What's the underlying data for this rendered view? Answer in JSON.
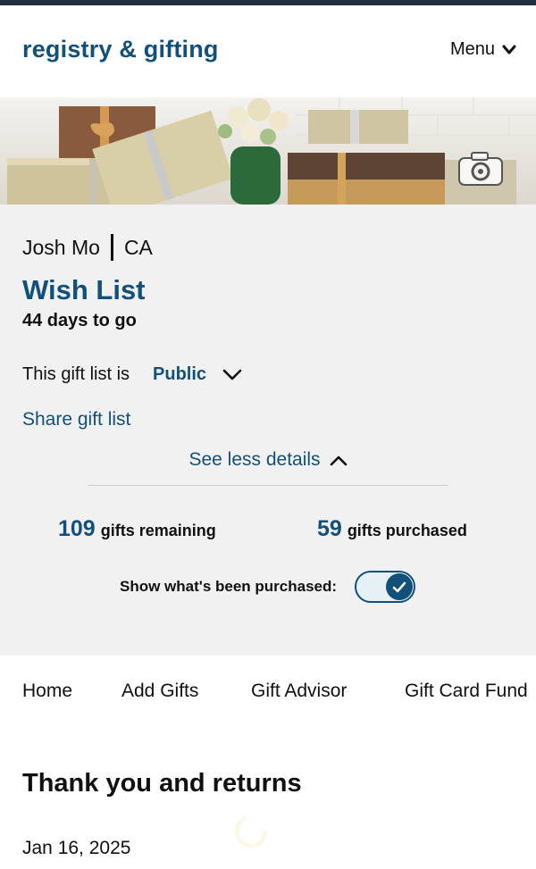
{
  "header": {
    "brand": "registry & gifting",
    "menu_label": "Menu"
  },
  "banner": {
    "camera_icon": "camera-icon"
  },
  "details": {
    "owner_name": "Josh Mo",
    "owner_region": "CA",
    "list_title": "Wish List",
    "countdown": "44 days to go",
    "privacy_prefix": "This gift list is",
    "privacy_value": "Public",
    "share_label": "Share gift list",
    "see_less_label": "See less details",
    "remaining_count": "109",
    "remaining_label": "gifts remaining",
    "purchased_count": "59",
    "purchased_label": "gifts purchased",
    "toggle_label": "Show what's been purchased:",
    "toggle_on": true
  },
  "tabs": [
    {
      "label": "Home"
    },
    {
      "label": "Add Gifts"
    },
    {
      "label": "Gift Advisor"
    },
    {
      "label": "Gift Card Fund"
    }
  ],
  "section": {
    "title": "Thank you and returns",
    "date": "Jan 16, 2025"
  },
  "colors": {
    "accent": "#11507a",
    "panel": "#f2f1f2",
    "topbar": "#232f3e"
  }
}
